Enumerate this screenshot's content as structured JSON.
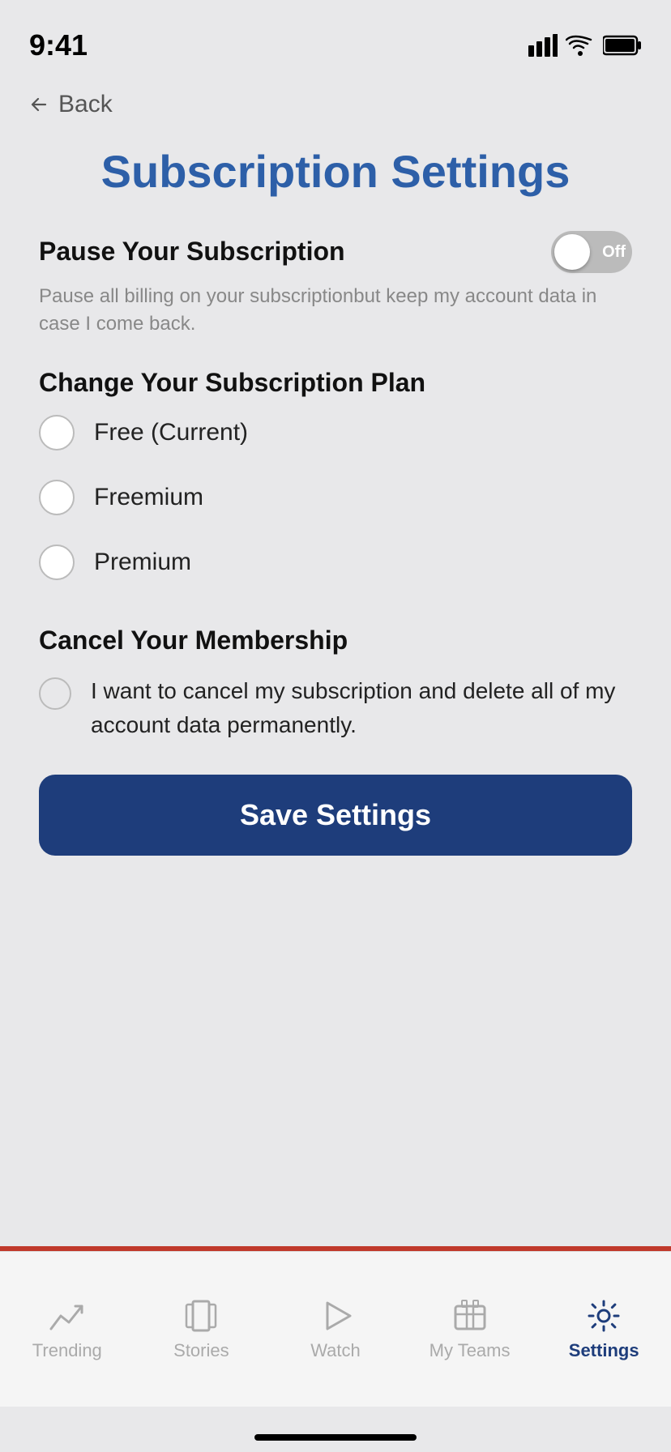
{
  "statusBar": {
    "time": "9:41"
  },
  "backButton": {
    "label": "Back"
  },
  "pageTitle": "Subscription Settings",
  "pauseSection": {
    "title": "Pause Your Subscription",
    "description": "Pause all billing on your subscriptionbut keep my account data in case I come back.",
    "toggleState": "Off"
  },
  "changePlanSection": {
    "title": "Change Your Subscription Plan",
    "options": [
      {
        "label": "Free (Current)",
        "selected": false
      },
      {
        "label": "Freemium",
        "selected": false
      },
      {
        "label": "Premium",
        "selected": false
      }
    ]
  },
  "cancelSection": {
    "title": "Cancel Your Membership",
    "checkboxText": "I want to cancel my subscription and delete all of my account data permanently."
  },
  "saveButton": {
    "label": "Save Settings"
  },
  "tabBar": {
    "tabs": [
      {
        "id": "trending",
        "label": "Trending",
        "active": false
      },
      {
        "id": "stories",
        "label": "Stories",
        "active": false
      },
      {
        "id": "watch",
        "label": "Watch",
        "active": false
      },
      {
        "id": "my-teams",
        "label": "My Teams",
        "active": false
      },
      {
        "id": "settings",
        "label": "Settings",
        "active": true
      }
    ]
  }
}
